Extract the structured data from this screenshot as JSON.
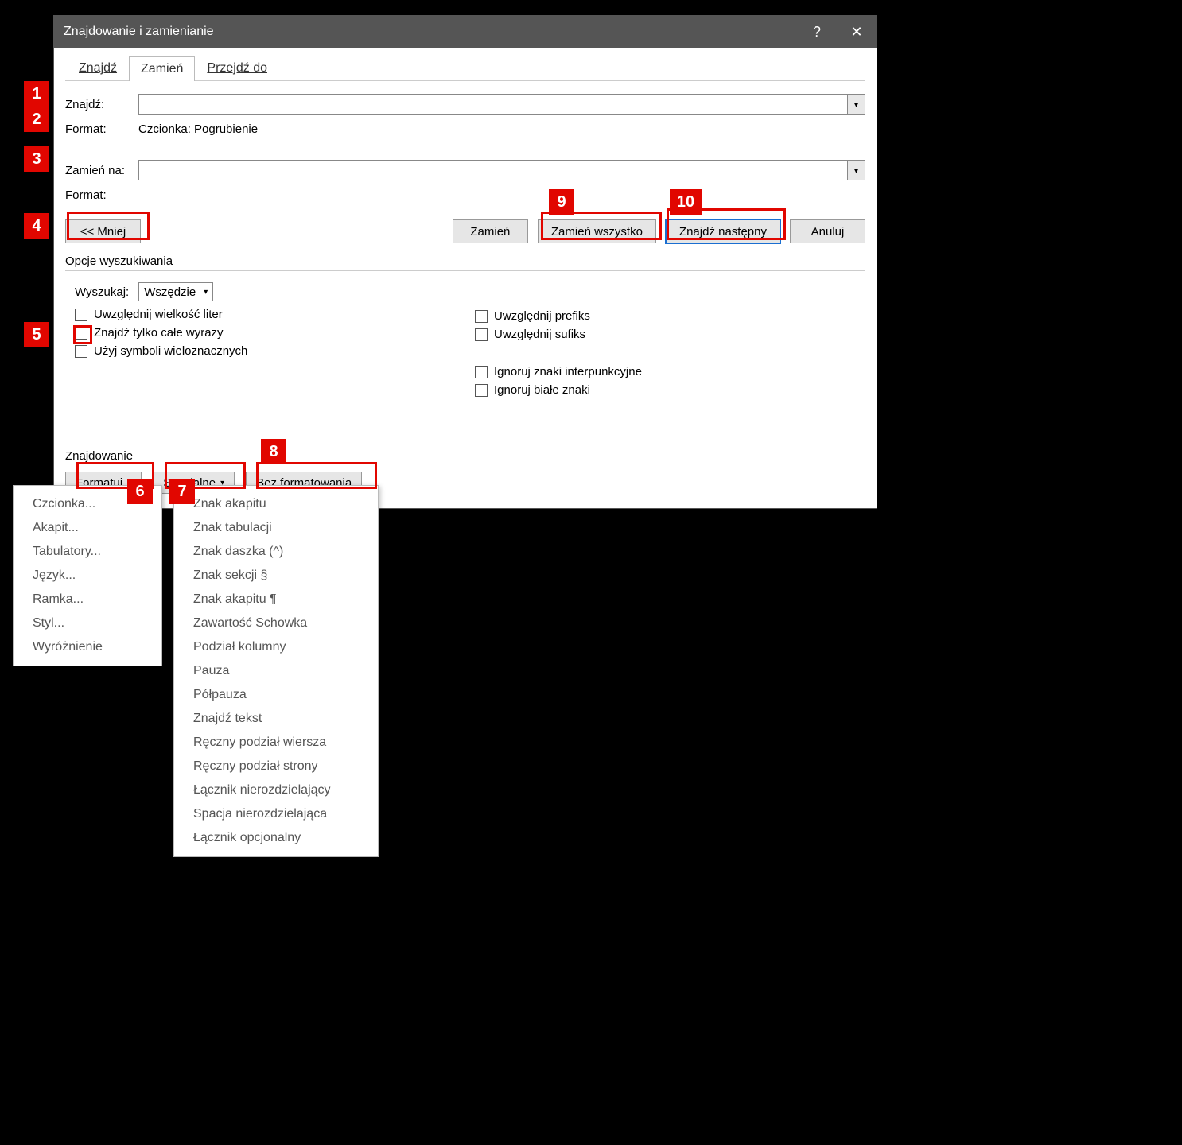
{
  "title": "Znajdowanie i zamienianie",
  "tabs": {
    "find": "Znajdź",
    "replace": "Zamień",
    "goto": "Przejdź do"
  },
  "find_label": "Znajdź:",
  "find_value": "",
  "format_label": "Format:",
  "find_format_value": "Czcionka: Pogrubienie",
  "replace_label": "Zamień na:",
  "replace_value": "",
  "replace_format_value": "",
  "buttons": {
    "less": "<< Mniej",
    "replace": "Zamień",
    "replace_all": "Zamień wszystko",
    "find_next": "Znajdź następny",
    "cancel": "Anuluj"
  },
  "search_options_title": "Opcje wyszukiwania",
  "search_dir_label": "Wyszukaj:",
  "search_dir_value": "Wszędzie",
  "checkboxes_left": [
    "Uwzględnij wielkość liter",
    "Znajdź tylko całe wyrazy",
    "Użyj symboli wieloznacznych"
  ],
  "checkboxes_right": [
    "Uwzględnij prefiks",
    "Uwzględnij sufiks",
    "Ignoruj znaki interpunkcyjne",
    "Ignoruj białe znaki"
  ],
  "find_section_title": "Znajdowanie",
  "bottom_buttons": {
    "format": "Formatuj",
    "special": "Specjalne",
    "no_formatting": "Bez formatowania"
  },
  "format_menu": [
    "Czcionka...",
    "Akapit...",
    "Tabulatory...",
    "Język...",
    "Ramka...",
    "Styl...",
    "Wyróżnienie"
  ],
  "special_menu": [
    "Znak akapitu",
    "Znak tabulacji",
    "Znak daszka (^)",
    "Znak sekcji §",
    "Znak akapitu ¶",
    "Zawartość Schowka",
    "Podział kolumny",
    "Pauza",
    "Półpauza",
    "Znajdź tekst",
    "Ręczny podział wiersza",
    "Ręczny podział strony",
    "Łącznik nierozdzielający",
    "Spacja nierozdzielająca",
    "Łącznik opcjonalny"
  ],
  "callouts": [
    "1",
    "2",
    "3",
    "4",
    "5",
    "6",
    "7",
    "8",
    "9",
    "10"
  ]
}
